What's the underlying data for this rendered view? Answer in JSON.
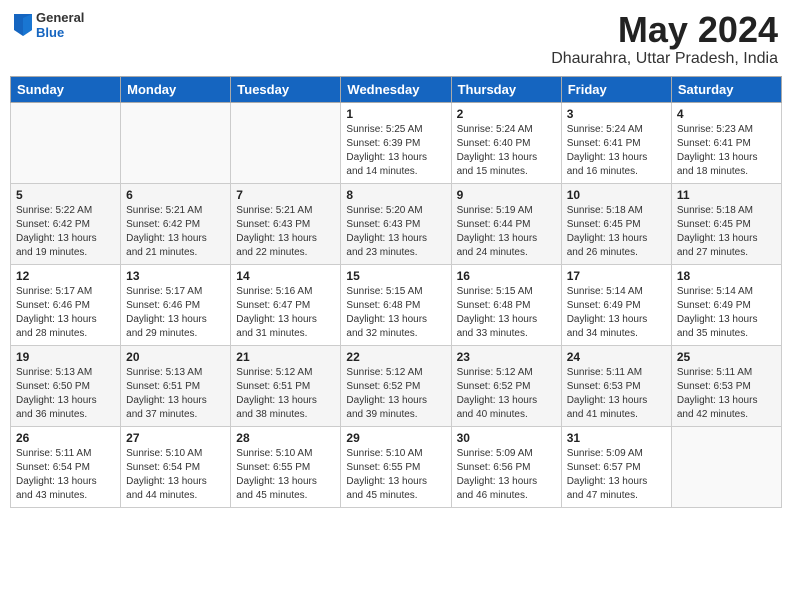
{
  "header": {
    "logo_general": "General",
    "logo_blue": "Blue",
    "month_title": "May 2024",
    "location": "Dhaurahra, Uttar Pradesh, India"
  },
  "weekdays": [
    "Sunday",
    "Monday",
    "Tuesday",
    "Wednesday",
    "Thursday",
    "Friday",
    "Saturday"
  ],
  "weeks": [
    [
      {
        "day": "",
        "info": ""
      },
      {
        "day": "",
        "info": ""
      },
      {
        "day": "",
        "info": ""
      },
      {
        "day": "1",
        "info": "Sunrise: 5:25 AM\nSunset: 6:39 PM\nDaylight: 13 hours\nand 14 minutes."
      },
      {
        "day": "2",
        "info": "Sunrise: 5:24 AM\nSunset: 6:40 PM\nDaylight: 13 hours\nand 15 minutes."
      },
      {
        "day": "3",
        "info": "Sunrise: 5:24 AM\nSunset: 6:41 PM\nDaylight: 13 hours\nand 16 minutes."
      },
      {
        "day": "4",
        "info": "Sunrise: 5:23 AM\nSunset: 6:41 PM\nDaylight: 13 hours\nand 18 minutes."
      }
    ],
    [
      {
        "day": "5",
        "info": "Sunrise: 5:22 AM\nSunset: 6:42 PM\nDaylight: 13 hours\nand 19 minutes."
      },
      {
        "day": "6",
        "info": "Sunrise: 5:21 AM\nSunset: 6:42 PM\nDaylight: 13 hours\nand 21 minutes."
      },
      {
        "day": "7",
        "info": "Sunrise: 5:21 AM\nSunset: 6:43 PM\nDaylight: 13 hours\nand 22 minutes."
      },
      {
        "day": "8",
        "info": "Sunrise: 5:20 AM\nSunset: 6:43 PM\nDaylight: 13 hours\nand 23 minutes."
      },
      {
        "day": "9",
        "info": "Sunrise: 5:19 AM\nSunset: 6:44 PM\nDaylight: 13 hours\nand 24 minutes."
      },
      {
        "day": "10",
        "info": "Sunrise: 5:18 AM\nSunset: 6:45 PM\nDaylight: 13 hours\nand 26 minutes."
      },
      {
        "day": "11",
        "info": "Sunrise: 5:18 AM\nSunset: 6:45 PM\nDaylight: 13 hours\nand 27 minutes."
      }
    ],
    [
      {
        "day": "12",
        "info": "Sunrise: 5:17 AM\nSunset: 6:46 PM\nDaylight: 13 hours\nand 28 minutes."
      },
      {
        "day": "13",
        "info": "Sunrise: 5:17 AM\nSunset: 6:46 PM\nDaylight: 13 hours\nand 29 minutes."
      },
      {
        "day": "14",
        "info": "Sunrise: 5:16 AM\nSunset: 6:47 PM\nDaylight: 13 hours\nand 31 minutes."
      },
      {
        "day": "15",
        "info": "Sunrise: 5:15 AM\nSunset: 6:48 PM\nDaylight: 13 hours\nand 32 minutes."
      },
      {
        "day": "16",
        "info": "Sunrise: 5:15 AM\nSunset: 6:48 PM\nDaylight: 13 hours\nand 33 minutes."
      },
      {
        "day": "17",
        "info": "Sunrise: 5:14 AM\nSunset: 6:49 PM\nDaylight: 13 hours\nand 34 minutes."
      },
      {
        "day": "18",
        "info": "Sunrise: 5:14 AM\nSunset: 6:49 PM\nDaylight: 13 hours\nand 35 minutes."
      }
    ],
    [
      {
        "day": "19",
        "info": "Sunrise: 5:13 AM\nSunset: 6:50 PM\nDaylight: 13 hours\nand 36 minutes."
      },
      {
        "day": "20",
        "info": "Sunrise: 5:13 AM\nSunset: 6:51 PM\nDaylight: 13 hours\nand 37 minutes."
      },
      {
        "day": "21",
        "info": "Sunrise: 5:12 AM\nSunset: 6:51 PM\nDaylight: 13 hours\nand 38 minutes."
      },
      {
        "day": "22",
        "info": "Sunrise: 5:12 AM\nSunset: 6:52 PM\nDaylight: 13 hours\nand 39 minutes."
      },
      {
        "day": "23",
        "info": "Sunrise: 5:12 AM\nSunset: 6:52 PM\nDaylight: 13 hours\nand 40 minutes."
      },
      {
        "day": "24",
        "info": "Sunrise: 5:11 AM\nSunset: 6:53 PM\nDaylight: 13 hours\nand 41 minutes."
      },
      {
        "day": "25",
        "info": "Sunrise: 5:11 AM\nSunset: 6:53 PM\nDaylight: 13 hours\nand 42 minutes."
      }
    ],
    [
      {
        "day": "26",
        "info": "Sunrise: 5:11 AM\nSunset: 6:54 PM\nDaylight: 13 hours\nand 43 minutes."
      },
      {
        "day": "27",
        "info": "Sunrise: 5:10 AM\nSunset: 6:54 PM\nDaylight: 13 hours\nand 44 minutes."
      },
      {
        "day": "28",
        "info": "Sunrise: 5:10 AM\nSunset: 6:55 PM\nDaylight: 13 hours\nand 45 minutes."
      },
      {
        "day": "29",
        "info": "Sunrise: 5:10 AM\nSunset: 6:55 PM\nDaylight: 13 hours\nand 45 minutes."
      },
      {
        "day": "30",
        "info": "Sunrise: 5:09 AM\nSunset: 6:56 PM\nDaylight: 13 hours\nand 46 minutes."
      },
      {
        "day": "31",
        "info": "Sunrise: 5:09 AM\nSunset: 6:57 PM\nDaylight: 13 hours\nand 47 minutes."
      },
      {
        "day": "",
        "info": ""
      }
    ]
  ]
}
